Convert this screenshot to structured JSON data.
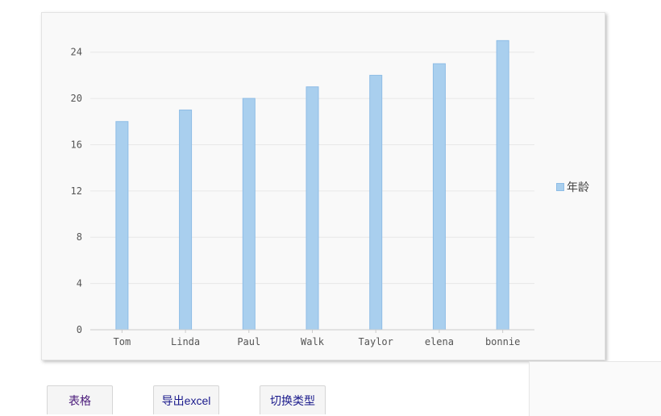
{
  "chart_data": {
    "type": "bar",
    "categories": [
      "Tom",
      "Linda",
      "Paul",
      "Walk",
      "Taylor",
      "elena",
      "bonnie"
    ],
    "series": [
      {
        "name": "年龄",
        "values": [
          18,
          19,
          20,
          21,
          22,
          23,
          25
        ],
        "color": "#a9cfee"
      }
    ],
    "ylim": [
      0,
      26
    ],
    "yticks": [
      0,
      4,
      8,
      12,
      16,
      20,
      24
    ],
    "grid": true,
    "legend_position": "right"
  },
  "colors": {
    "bar_fill": "#a9cfee",
    "bar_stroke": "#8ebde6",
    "grid": "#e8e8e8",
    "axis": "#cccccc"
  },
  "buttons": {
    "table_label": "表格",
    "export_label": "导出excel",
    "switch_label": "切换类型"
  }
}
